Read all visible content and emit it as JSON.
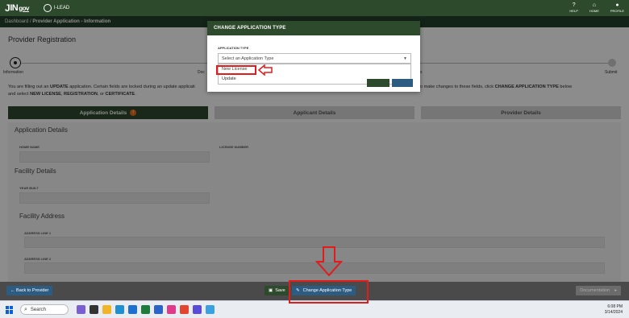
{
  "header": {
    "logo_text": "IN",
    "logo_gov": "gov",
    "app_name": "I-LEAD",
    "icons": [
      {
        "name": "help-icon",
        "label": "HELP",
        "glyph": "?"
      },
      {
        "name": "home-icon",
        "label": "HOME",
        "glyph": "⌂"
      },
      {
        "name": "profile-icon",
        "label": "PROFILE",
        "glyph": "●"
      }
    ]
  },
  "breadcrumb": {
    "root": "Dashboard",
    "current": "Provider Application - Information"
  },
  "page": {
    "title": "Provider Registration",
    "steps": {
      "first": "Information",
      "middle_partial": "Doc",
      "middle_right_partial": "s",
      "last": "Submit"
    },
    "notice": {
      "part1": "You are filling out an ",
      "update_word": "UPDATE",
      "part2": " application. Certain fields are locked during an update applicati",
      "part3": " would like to make changes to these fields, click ",
      "change_word": "CHANGE APPLICATION TYPE",
      "part4": " below",
      "line2_a": "and select ",
      "new_license": "NEW LICENSE",
      "comma1": ", ",
      "registration": "REGISTRATION",
      "or": ", or ",
      "certificate": "CERTIFICATE",
      "period": "."
    },
    "tabs": [
      {
        "label": "Application Details",
        "badge": "!"
      },
      {
        "label": "Applicant Details"
      },
      {
        "label": "Provider Details"
      }
    ],
    "sections": {
      "application_details": "Application Details",
      "home_name_label": "HOME NAME",
      "license_number_label": "LICENSE NUMBER",
      "facility_details": "Facility Details",
      "year_built_label": "YEAR BUILT",
      "facility_address": "Facility Address",
      "address1_label": "ADDRESS LINE 1",
      "address2_label": "ADDRESS LINE 2"
    }
  },
  "footer": {
    "back_label": "← Back to Provider",
    "save_label": "Save",
    "change_label": "Change Application Type",
    "doc_label": "Documentation"
  },
  "modal": {
    "title": "CHANGE APPLICATION TYPE",
    "field_label": "APPLICATION TYPE",
    "select_placeholder": "Select an Application Type",
    "options": [
      "New License",
      "Update"
    ]
  },
  "taskbar": {
    "search_placeholder": "Search",
    "time": "6:08 PM",
    "date": "3/14/2024"
  },
  "colors": {
    "header_green": "#2e4a2c",
    "footer_blue": "#2d5c82",
    "annotation_red": "#e21b1b",
    "badge_orange": "#e86a1a"
  }
}
